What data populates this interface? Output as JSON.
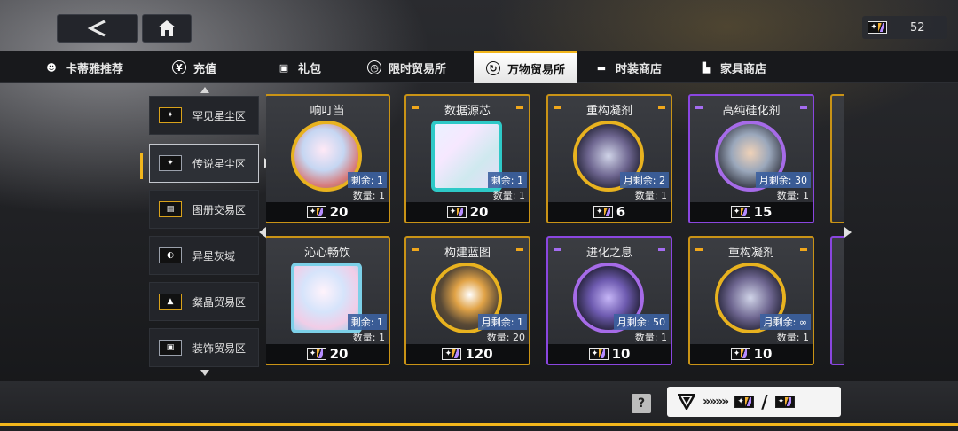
{
  "currency": {
    "amount": "52",
    "icon": "star-ticket-icon"
  },
  "tabs": [
    {
      "label": "卡蒂雅推荐",
      "icon": "character-icon"
    },
    {
      "label": "充值",
      "icon": "yen-icon"
    },
    {
      "label": "礼包",
      "icon": "gift-icon"
    },
    {
      "label": "限时贸易所",
      "icon": "clock-icon"
    },
    {
      "label": "万物贸易所",
      "icon": "cycle-icon",
      "active": true
    },
    {
      "label": "时装商店",
      "icon": "card-icon"
    },
    {
      "label": "家具商店",
      "icon": "sofa-icon"
    }
  ],
  "side": [
    {
      "label": "罕见星尘区"
    },
    {
      "label": "传说星尘区",
      "active": true
    },
    {
      "label": "图册交易区"
    },
    {
      "label": "异星灰域"
    },
    {
      "label": "粲晶贸易区"
    },
    {
      "label": "装饰贸易区"
    }
  ],
  "cards": [
    {
      "name": "响叮当",
      "remain": "剩余: 1",
      "qty": "数量: 1",
      "price": "20",
      "rarity": "gold"
    },
    {
      "name": "数据源芯",
      "remain": "剩余: 1",
      "qty": "数量: 1",
      "price": "20",
      "rarity": "gold"
    },
    {
      "name": "重构凝剂",
      "remain": "月剩余: 2",
      "qty": "数量: 1",
      "price": "6",
      "rarity": "gold"
    },
    {
      "name": "高纯硅化剂",
      "remain": "月剩余: 30",
      "qty": "数量: 1",
      "price": "15",
      "rarity": "purple"
    },
    {
      "name": "沁心畅饮",
      "remain": "剩余: 1",
      "qty": "数量: 1",
      "price": "20",
      "rarity": "gold"
    },
    {
      "name": "构建蓝图",
      "remain": "月剩余: 1",
      "qty": "数量: 20",
      "price": "120",
      "rarity": "gold"
    },
    {
      "name": "进化之息",
      "remain": "月剩余: 50",
      "qty": "数量: 1",
      "price": "10",
      "rarity": "purple"
    },
    {
      "name": "重构凝剂",
      "remain": "月剩余: ∞",
      "qty": "数量: 1",
      "price": "10",
      "rarity": "gold"
    }
  ],
  "bottom": {
    "help": "?",
    "divider": "/"
  }
}
